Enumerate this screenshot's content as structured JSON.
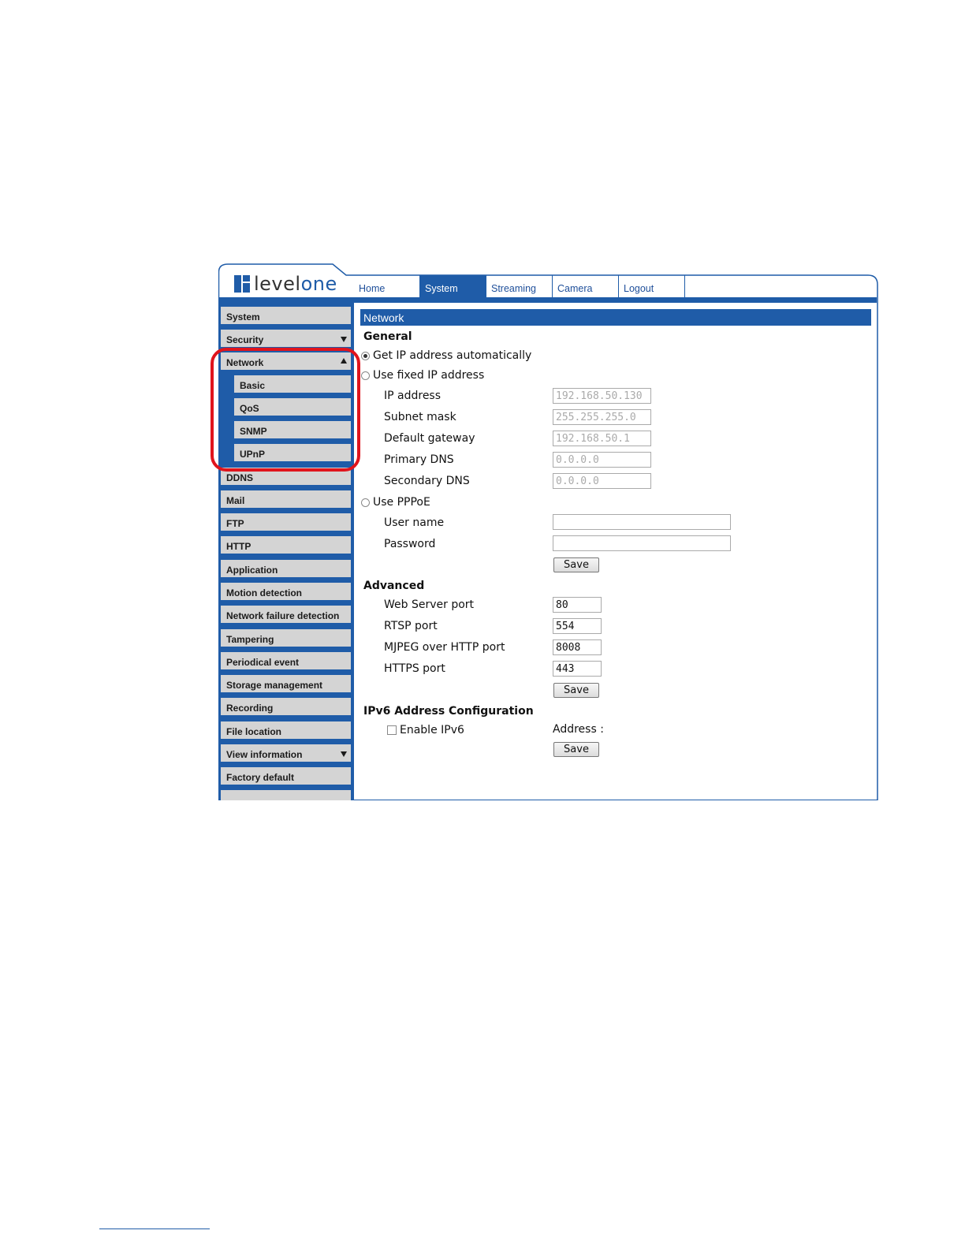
{
  "brand": {
    "logo_text": "levelone",
    "logo_prefix": "level",
    "logo_suffix": "one",
    "accent_color": "#1f5ca8",
    "highlight_color": "#e0141c"
  },
  "nav": {
    "tabs": [
      {
        "label": "Home",
        "active": false
      },
      {
        "label": "System",
        "active": true
      },
      {
        "label": "Streaming",
        "active": false
      },
      {
        "label": "Camera",
        "active": false
      },
      {
        "label": "Logout",
        "active": false
      }
    ]
  },
  "sidebar": {
    "items": [
      {
        "label": "System",
        "arrow": ""
      },
      {
        "label": "Security",
        "arrow": "down"
      },
      {
        "label": "Network",
        "arrow": "up"
      },
      {
        "label": "Basic",
        "sub": true
      },
      {
        "label": "QoS",
        "sub": true
      },
      {
        "label": "SNMP",
        "sub": true
      },
      {
        "label": "UPnP",
        "sub": true
      },
      {
        "label": "DDNS"
      },
      {
        "label": "Mail"
      },
      {
        "label": "FTP"
      },
      {
        "label": "HTTP"
      },
      {
        "label": "Application"
      },
      {
        "label": "Motion detection"
      },
      {
        "label": "Network failure detection"
      },
      {
        "label": "Tampering"
      },
      {
        "label": "Periodical event"
      },
      {
        "label": "Storage management"
      },
      {
        "label": "Recording"
      },
      {
        "label": "File location"
      },
      {
        "label": "View information",
        "arrow": "down"
      },
      {
        "label": "Factory default"
      }
    ]
  },
  "panel": {
    "title": "Network",
    "general": {
      "heading": "General",
      "opt_auto": "Get IP address automatically",
      "opt_fixed": "Use fixed IP address",
      "ip_label": "IP address",
      "ip_value": "192.168.50.130",
      "mask_label": "Subnet mask",
      "mask_value": "255.255.255.0",
      "gateway_label": "Default gateway",
      "gateway_value": "192.168.50.1",
      "dns1_label": "Primary DNS",
      "dns1_value": "0.0.0.0",
      "dns2_label": "Secondary DNS",
      "dns2_value": "0.0.0.0",
      "opt_pppoe": "Use PPPoE",
      "user_label": "User name",
      "user_value": "",
      "pass_label": "Password",
      "pass_value": "",
      "save_label": "Save"
    },
    "advanced": {
      "heading": "Advanced",
      "web_label": "Web Server port",
      "web_value": "80",
      "rtsp_label": "RTSP port",
      "rtsp_value": "554",
      "mjpeg_label": "MJPEG over HTTP port",
      "mjpeg_value": "8008",
      "https_label": "HTTPS port",
      "https_value": "443",
      "save_label": "Save"
    },
    "ipv6": {
      "heading": "IPv6 Address Configuration",
      "enable_label": "Enable IPv6",
      "address_label": "Address :",
      "save_label": "Save"
    }
  }
}
